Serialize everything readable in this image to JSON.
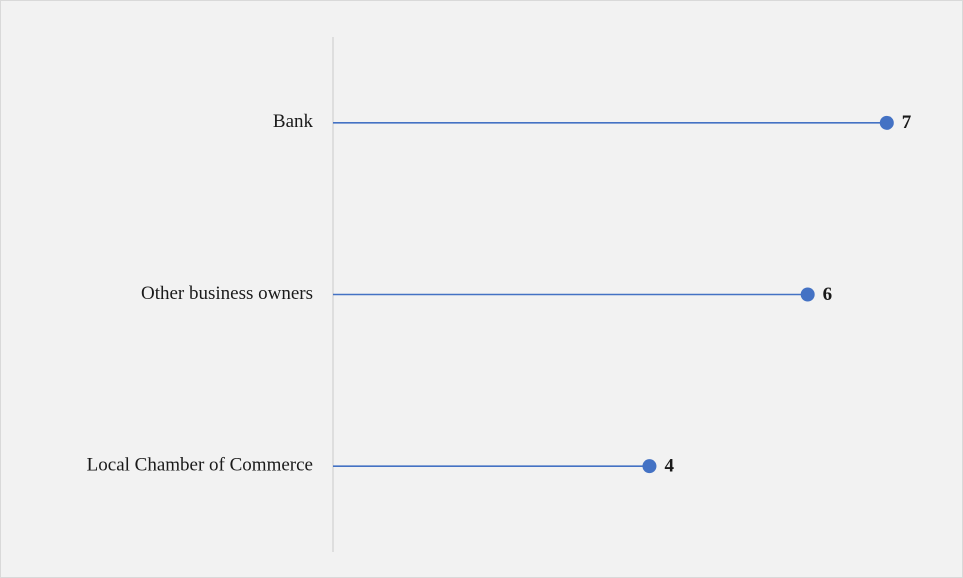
{
  "chart_data": {
    "type": "lollipop",
    "categories": [
      "Bank",
      "Other business owners",
      "Local Chamber of Commerce"
    ],
    "values": [
      7,
      6,
      4
    ],
    "xlim": [
      0,
      7.9
    ],
    "title": "",
    "xlabel": "",
    "ylabel": "",
    "grid": false,
    "legend": "none",
    "colors": {
      "series": "#4472c4",
      "axis": "#d0d0d0",
      "background": "#f2f2f2",
      "text": "#1a1a1a"
    }
  }
}
